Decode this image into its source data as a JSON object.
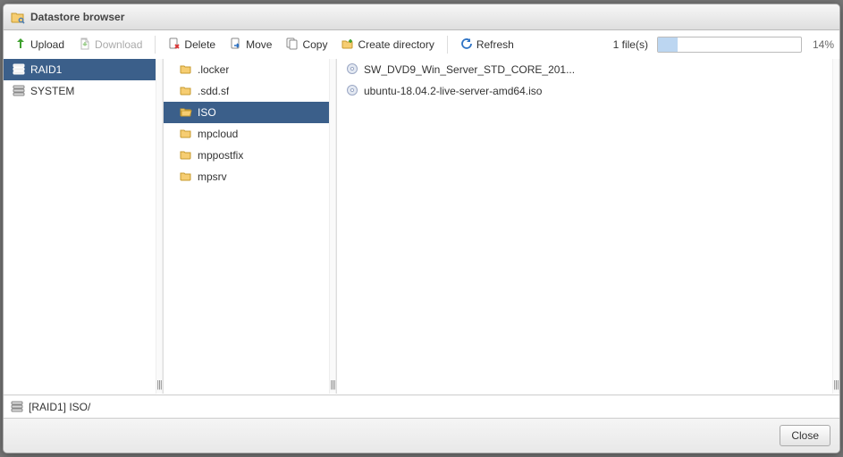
{
  "window": {
    "title": "Datastore browser"
  },
  "toolbar": {
    "upload": "Upload",
    "download": "Download",
    "delete": "Delete",
    "move": "Move",
    "copy": "Copy",
    "create_dir": "Create directory",
    "refresh": "Refresh",
    "filecount": "1 file(s)",
    "progress_pct_text": "14%",
    "progress_pct_value": 14
  },
  "datastores": {
    "items": [
      {
        "label": "RAID1",
        "selected": true
      },
      {
        "label": "SYSTEM",
        "selected": false
      }
    ]
  },
  "folders": {
    "items": [
      {
        "label": ".locker",
        "selected": false
      },
      {
        "label": ".sdd.sf",
        "selected": false
      },
      {
        "label": "ISO",
        "selected": true
      },
      {
        "label": "mpcloud",
        "selected": false
      },
      {
        "label": "mppostfix",
        "selected": false
      },
      {
        "label": "mpsrv",
        "selected": false
      }
    ]
  },
  "files": {
    "items": [
      {
        "label": "SW_DVD9_Win_Server_STD_CORE_201..."
      },
      {
        "label": "ubuntu-18.04.2-live-server-amd64.iso"
      }
    ]
  },
  "path": "[RAID1] ISO/",
  "footer": {
    "close": "Close"
  },
  "gutter_glyph": "|||"
}
